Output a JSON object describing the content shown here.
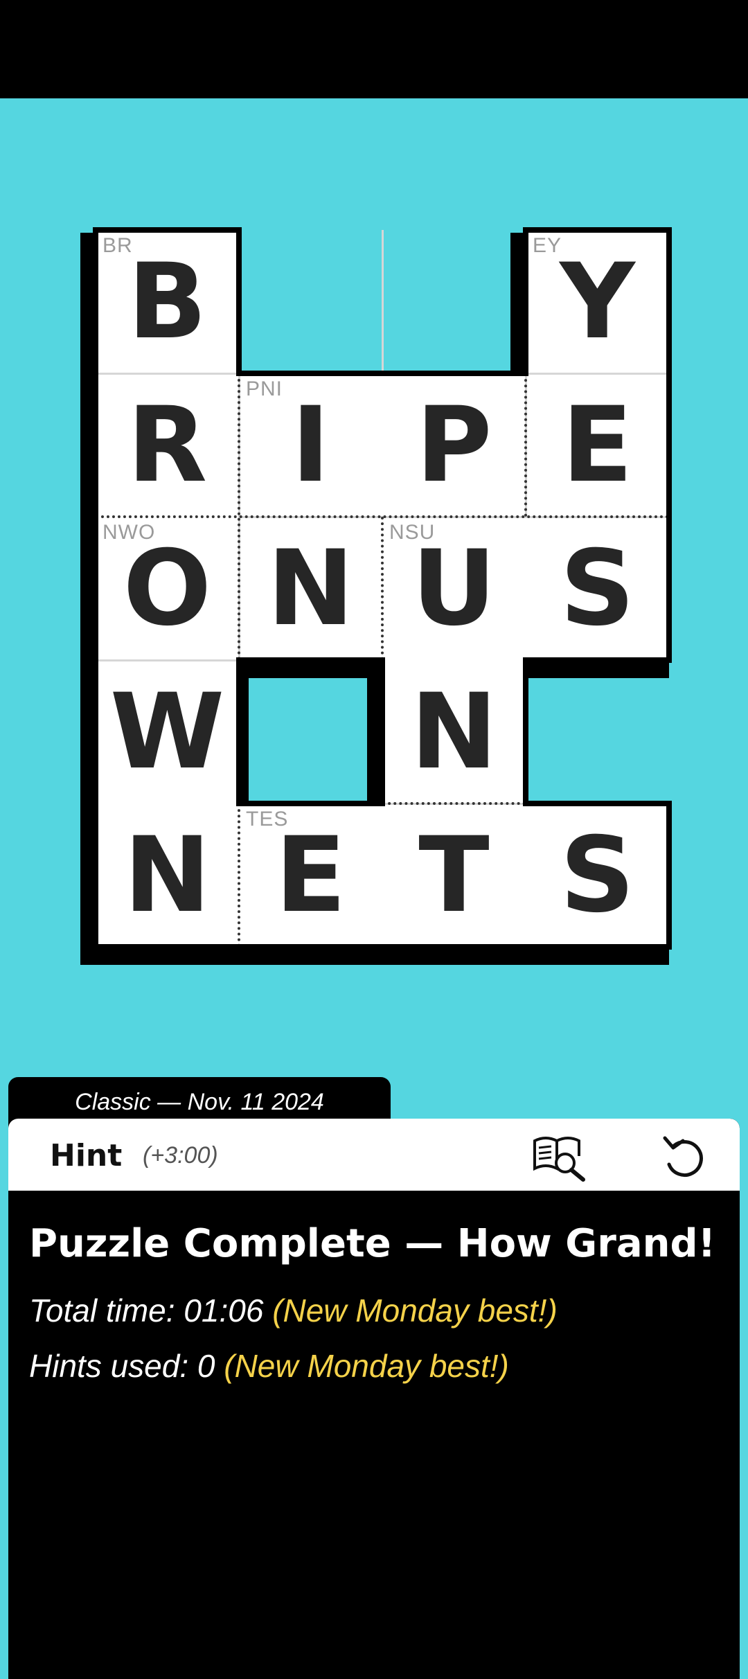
{
  "board": {
    "cells": [
      {
        "row": 0,
        "col": 0,
        "letter": "B",
        "clue": "BR"
      },
      {
        "row": 0,
        "col": 3,
        "letter": "Y",
        "clue": "EY"
      },
      {
        "row": 1,
        "col": 0,
        "letter": "R",
        "clue": ""
      },
      {
        "row": 1,
        "col": 1,
        "letter": "I",
        "clue": "PNI"
      },
      {
        "row": 1,
        "col": 2,
        "letter": "P",
        "clue": ""
      },
      {
        "row": 1,
        "col": 3,
        "letter": "E",
        "clue": ""
      },
      {
        "row": 2,
        "col": 0,
        "letter": "O",
        "clue": "NWO"
      },
      {
        "row": 2,
        "col": 1,
        "letter": "N",
        "clue": ""
      },
      {
        "row": 2,
        "col": 2,
        "letter": "U",
        "clue": "NSU"
      },
      {
        "row": 2,
        "col": 3,
        "letter": "S",
        "clue": ""
      },
      {
        "row": 3,
        "col": 0,
        "letter": "W",
        "clue": ""
      },
      {
        "row": 3,
        "col": 2,
        "letter": "N",
        "clue": ""
      },
      {
        "row": 4,
        "col": 0,
        "letter": "N",
        "clue": ""
      },
      {
        "row": 4,
        "col": 1,
        "letter": "E",
        "clue": "TES"
      },
      {
        "row": 4,
        "col": 2,
        "letter": "T",
        "clue": ""
      },
      {
        "row": 4,
        "col": 3,
        "letter": "S",
        "clue": ""
      }
    ]
  },
  "puzzle": {
    "tab_label": "Classic — Nov. 11 2024"
  },
  "toolbar": {
    "hint_label": "Hint",
    "hint_penalty": "(+3:00)",
    "lookup_icon": "book-magnifier-icon",
    "undo_icon": "undo-icon"
  },
  "result": {
    "title": "Puzzle Complete — How Grand!",
    "total_time_label": "Total time: 01:06",
    "total_time_note": "(New Monday best!)",
    "hints_label": "Hints used: 0",
    "hints_note": "(New Monday best!)"
  },
  "colors": {
    "background": "#55d6e0",
    "panel": "#000000",
    "highlight": "#f5d24a"
  }
}
